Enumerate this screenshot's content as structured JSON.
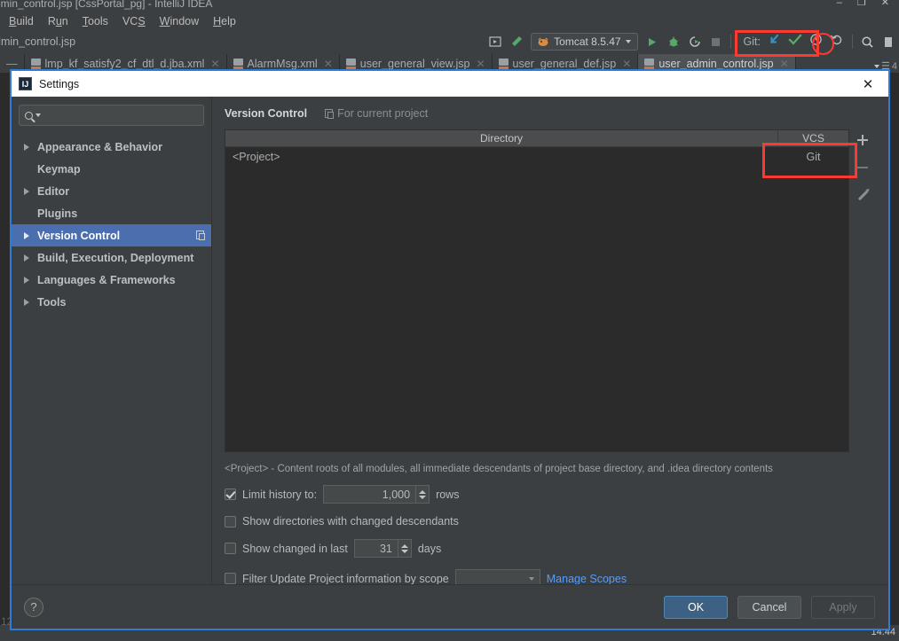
{
  "ide": {
    "window_title": "dmin_control.jsp [CssPortal_pg] - IntelliJ IDEA",
    "menu": [
      {
        "label": "Build",
        "mnemonic": "B"
      },
      {
        "label": "Run",
        "mnemonic": "u"
      },
      {
        "label": "Tools",
        "mnemonic": "T"
      },
      {
        "label": "VCS",
        "mnemonic": "S"
      },
      {
        "label": "Window",
        "mnemonic": "W"
      },
      {
        "label": "Help",
        "mnemonic": "H"
      }
    ],
    "breadcrumb": "dmin_control.jsp",
    "run_config": "Tomcat 8.5.47",
    "git_label": "Git:",
    "toolbar_icons": [
      "run-with-coverage-icon",
      "build-hammer-icon",
      "run-icon",
      "debug-icon",
      "run-profiler-icon",
      "stop-icon",
      "update-project-icon",
      "commit-icon",
      "show-history-icon",
      "rollback-icon",
      "search-everywhere-icon"
    ],
    "tabs": [
      {
        "label": "lmp_kf_satisfy2_cf_dtl_d.jba.xml",
        "active": false
      },
      {
        "label": "AlarmMsg.xml",
        "active": false
      },
      {
        "label": "user_general_view.jsp",
        "active": false
      },
      {
        "label": "user_general_def.jsp",
        "active": false
      },
      {
        "label": "user_admin_control.jsp",
        "active": true
      }
    ],
    "tab_overflow_count": "4",
    "gutter_line": "12",
    "clock": "14:44"
  },
  "dialog": {
    "title": "Settings",
    "icon_text": "IJ",
    "close_label": "✕",
    "search": {
      "placeholder": "",
      "value": ""
    },
    "sidebar": [
      {
        "label": "Appearance & Behavior",
        "expandable": true,
        "selected": false
      },
      {
        "label": "Keymap",
        "expandable": false,
        "selected": false
      },
      {
        "label": "Editor",
        "expandable": true,
        "selected": false
      },
      {
        "label": "Plugins",
        "expandable": false,
        "selected": false
      },
      {
        "label": "Version Control",
        "expandable": true,
        "selected": true
      },
      {
        "label": "Build, Execution, Deployment",
        "expandable": true,
        "selected": false
      },
      {
        "label": "Languages & Frameworks",
        "expandable": true,
        "selected": false
      },
      {
        "label": "Tools",
        "expandable": true,
        "selected": false
      }
    ],
    "main": {
      "title": "Version Control",
      "scope_note": "For current project",
      "table": {
        "columns": [
          "Directory",
          "VCS"
        ],
        "rows": [
          {
            "directory": "<Project>",
            "vcs": "Git"
          }
        ]
      },
      "side_buttons": [
        "add-button",
        "remove-button",
        "edit-button"
      ],
      "hint": "<Project> - Content roots of all modules, all immediate descendants of project base directory, and .idea directory contents",
      "options": {
        "limit_history": {
          "label": "Limit history to:",
          "checked": true,
          "value": "1,000",
          "suffix": "rows"
        },
        "show_dirs_changed": {
          "label": "Show directories with changed descendants",
          "checked": false
        },
        "show_changed_last": {
          "label": "Show changed in last",
          "checked": false,
          "value": "31",
          "suffix": "days"
        },
        "filter_by_scope": {
          "label": "Filter Update Project information by scope",
          "checked": false,
          "scope_value": "",
          "manage_link": "Manage Scopes"
        }
      }
    },
    "footer": {
      "help": "?",
      "ok": "OK",
      "cancel": "Cancel",
      "apply": "Apply"
    }
  },
  "annotations": {
    "git_toolbar_box": "red-rect-git-toolbar",
    "git_history_circle": "red-circle-history-icon",
    "vcs_git_cell_box": "red-rect-git-vcs-cell"
  },
  "colors": {
    "accent_blue": "#4b6eaf",
    "annotation_red": "#fd3a32",
    "dialog_border": "#2d7cd6",
    "panel_bg": "#3c3f41",
    "table_bg": "#2b2b2b",
    "link": "#589df6",
    "git_update": "#3592c4",
    "git_commit": "#59a869"
  }
}
